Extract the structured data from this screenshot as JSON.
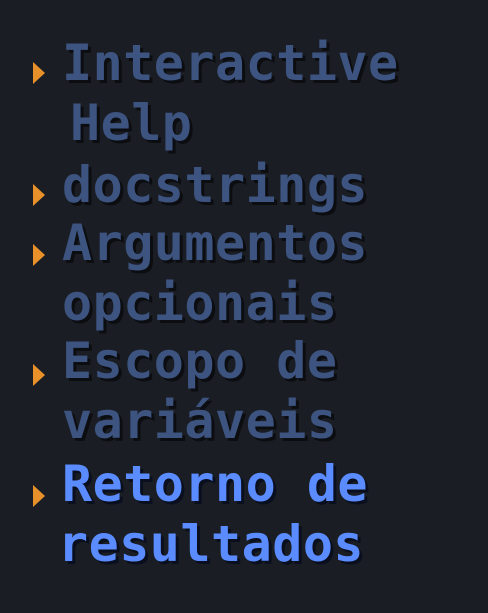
{
  "menu": {
    "items": [
      {
        "lines": [
          "Interactive",
          "Help"
        ],
        "active": false
      },
      {
        "lines": [
          "docstrings"
        ],
        "active": false
      },
      {
        "lines": [
          "Argumentos",
          "opcionais"
        ],
        "active": false
      },
      {
        "lines": [
          "Escopo de",
          "variáveis"
        ],
        "active": false
      },
      {
        "lines": [
          "Retorno de",
          "resultados"
        ],
        "active": true
      }
    ]
  },
  "colors": {
    "background": "#1a1e24",
    "inactive_text": "#3d5380",
    "active_text": "#5b8cff",
    "bullet": "#e8902a"
  }
}
